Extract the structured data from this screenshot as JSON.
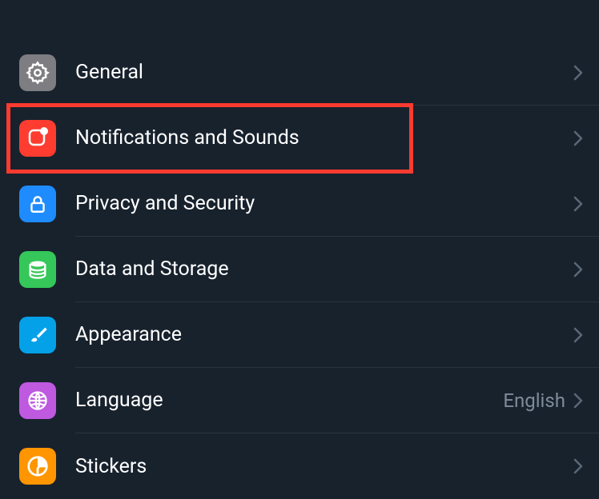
{
  "settings": [
    {
      "id": "general",
      "label": "General",
      "icon": "gear",
      "bg": "#7d7d82"
    },
    {
      "id": "notifications",
      "label": "Notifications and Sounds",
      "icon": "bell",
      "bg": "#fe3c30",
      "highlighted": true
    },
    {
      "id": "privacy",
      "label": "Privacy and Security",
      "icon": "lock",
      "bg": "#1e8cff"
    },
    {
      "id": "data",
      "label": "Data and Storage",
      "icon": "stack",
      "bg": "#35c759"
    },
    {
      "id": "appearance",
      "label": "Appearance",
      "icon": "brush",
      "bg": "#04a1e9"
    },
    {
      "id": "language",
      "label": "Language",
      "icon": "globe",
      "bg": "#be59e0",
      "value": "English"
    },
    {
      "id": "stickers",
      "label": "Stickers",
      "icon": "sticker",
      "bg": "#ff9500"
    }
  ]
}
